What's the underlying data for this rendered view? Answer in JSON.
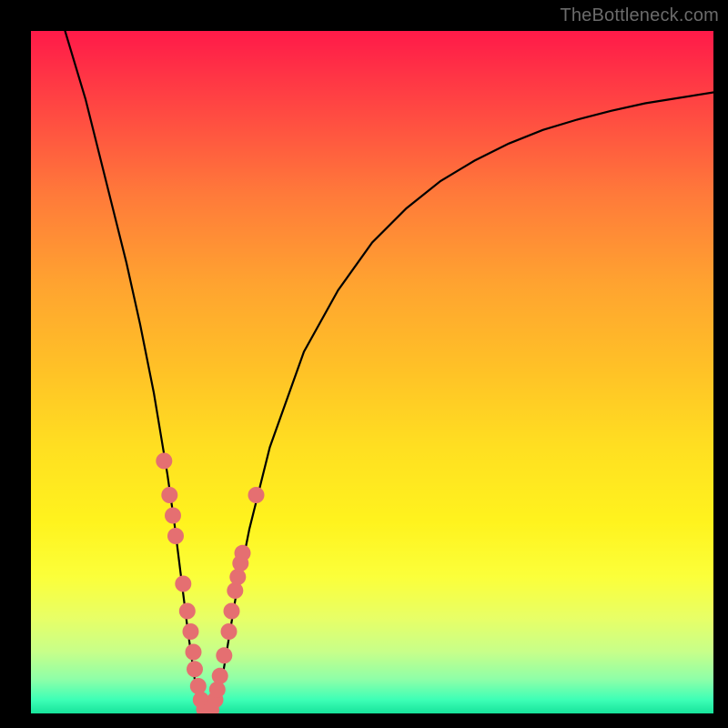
{
  "watermark": "TheBottleneck.com",
  "colors": {
    "frame": "#000000",
    "curve_stroke": "#000000",
    "marker_fill": "#e56f71",
    "marker_stroke": "#d85d60"
  },
  "chart_data": {
    "type": "line",
    "title": "",
    "xlabel": "",
    "ylabel": "",
    "xlim": [
      0,
      100
    ],
    "ylim": [
      0,
      100
    ],
    "series": [
      {
        "name": "bottleneck-curve",
        "x": [
          5,
          8,
          10,
          12,
          14,
          16,
          18,
          19,
          20,
          21,
          22,
          23,
          24,
          25,
          26,
          27,
          28,
          29,
          30,
          32,
          35,
          40,
          45,
          50,
          55,
          60,
          65,
          70,
          75,
          80,
          85,
          90,
          95,
          100
        ],
        "y": [
          100,
          90,
          82,
          74,
          66,
          57,
          47,
          41,
          35,
          28,
          20,
          12,
          5,
          1,
          0,
          1,
          5,
          11,
          17,
          27,
          39,
          53,
          62,
          69,
          74,
          78,
          81,
          83.5,
          85.5,
          87,
          88.3,
          89.4,
          90.2,
          91
        ]
      }
    ],
    "markers": [
      {
        "x": 19.5,
        "y": 37
      },
      {
        "x": 20.3,
        "y": 32
      },
      {
        "x": 20.8,
        "y": 29
      },
      {
        "x": 21.2,
        "y": 26
      },
      {
        "x": 22.3,
        "y": 19
      },
      {
        "x": 22.9,
        "y": 15
      },
      {
        "x": 23.4,
        "y": 12
      },
      {
        "x": 23.8,
        "y": 9
      },
      {
        "x": 24.0,
        "y": 6.5
      },
      {
        "x": 24.5,
        "y": 4
      },
      {
        "x": 24.9,
        "y": 2
      },
      {
        "x": 25.4,
        "y": 0.6
      },
      {
        "x": 25.9,
        "y": 0.2
      },
      {
        "x": 26.4,
        "y": 0.5
      },
      {
        "x": 27.0,
        "y": 2
      },
      {
        "x": 27.3,
        "y": 3.5
      },
      {
        "x": 27.7,
        "y": 5.5
      },
      {
        "x": 28.3,
        "y": 8.5
      },
      {
        "x": 29.0,
        "y": 12
      },
      {
        "x": 29.4,
        "y": 15
      },
      {
        "x": 29.9,
        "y": 18
      },
      {
        "x": 30.3,
        "y": 20
      },
      {
        "x": 30.7,
        "y": 22
      },
      {
        "x": 31.0,
        "y": 23.5
      },
      {
        "x": 33.0,
        "y": 32
      }
    ]
  }
}
